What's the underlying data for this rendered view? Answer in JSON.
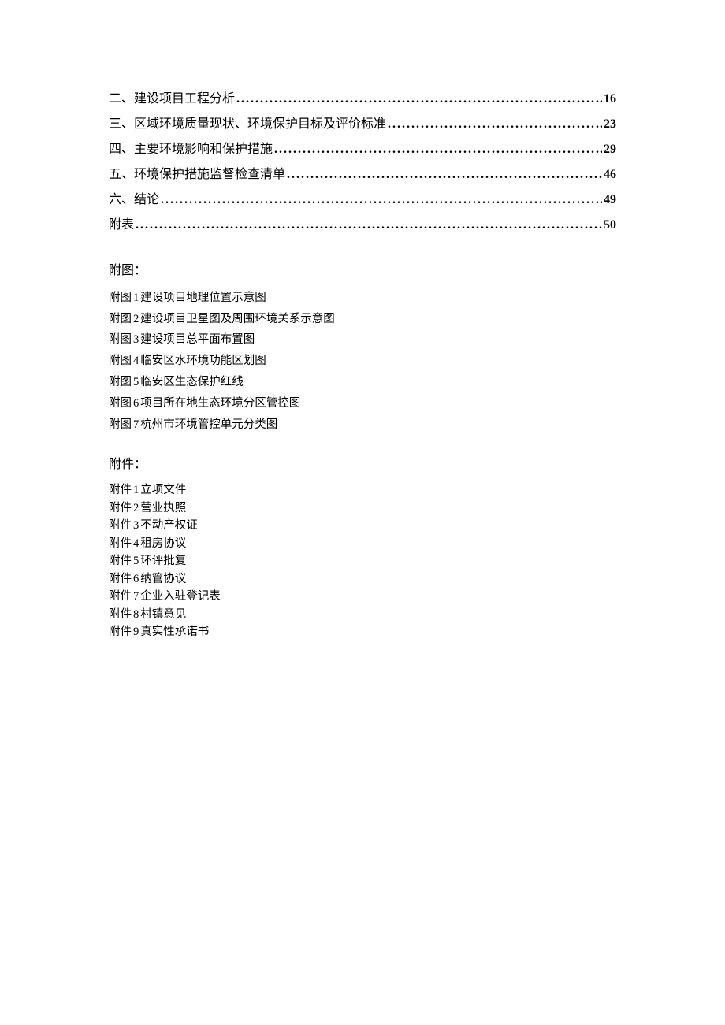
{
  "toc": [
    {
      "title": "二、建设项目工程分析",
      "page": "16"
    },
    {
      "title": "三、区域环境质量现状、环境保护目标及评价标准",
      "page": "23"
    },
    {
      "title": "四、主要环境影响和保护措施",
      "page": "29"
    },
    {
      "title": "五、环境保护措施监督检查清单",
      "page": "46"
    },
    {
      "title": "六、结论",
      "page": "49"
    },
    {
      "title": "附表",
      "page": "50"
    }
  ],
  "futuHeading": "附图：",
  "futu": [
    {
      "prefix": "附图",
      "num": "1",
      "text": "建设项目地理位置示意图"
    },
    {
      "prefix": "附图",
      "num": "2",
      "text": "建设项目卫星图及周围环境关系示意图"
    },
    {
      "prefix": "附图",
      "num": "3",
      "text": "建设项目总平面布置图"
    },
    {
      "prefix": "附图",
      "num": "4",
      "text": "临安区水环境功能区划图"
    },
    {
      "prefix": "附图",
      "num": "5",
      "text": "临安区生态保护红线"
    },
    {
      "prefix": "附图",
      "num": "6",
      "text": "项目所在地生态环境分区管控图"
    },
    {
      "prefix": "附图",
      "num": "7",
      "text": "杭州市环境管控单元分类图"
    }
  ],
  "fujianHeading": "附件：",
  "fujian": [
    {
      "prefix": "附件",
      "num": "1",
      "text": "立项文件"
    },
    {
      "prefix": "附件",
      "num": "2",
      "text": "营业执照"
    },
    {
      "prefix": "附件",
      "num": "3",
      "text": "不动产权证"
    },
    {
      "prefix": "附件",
      "num": "4",
      "text": "租房协议"
    },
    {
      "prefix": "附件",
      "num": "5",
      "text": "环评批复"
    },
    {
      "prefix": "附件",
      "num": "6",
      "text": "纳管协议"
    },
    {
      "prefix": "附件",
      "num": "7",
      "text": "企业入驻登记表"
    },
    {
      "prefix": "附件",
      "num": "8",
      "text": "村镇意见"
    },
    {
      "prefix": "附件",
      "num": "9",
      "text": "真实性承诺书"
    }
  ]
}
